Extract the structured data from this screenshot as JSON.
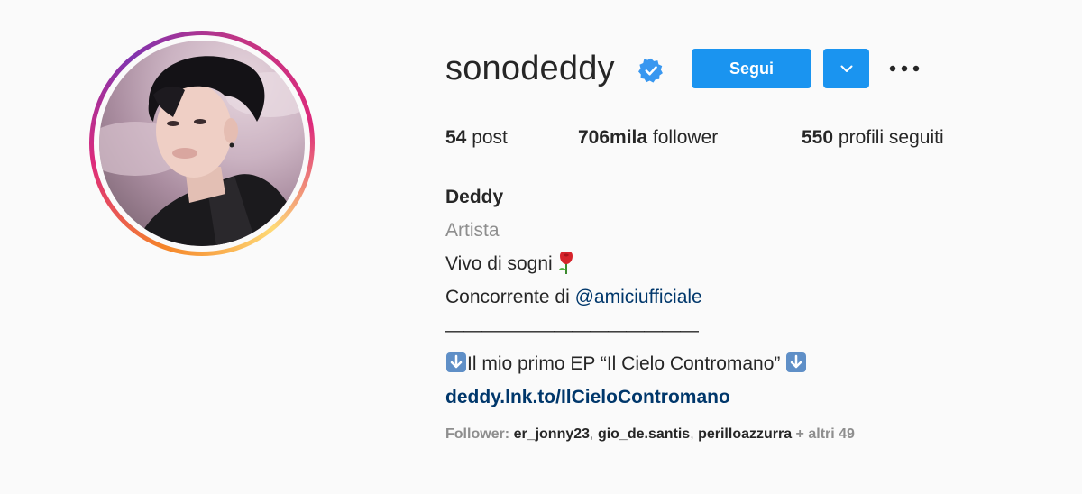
{
  "profile": {
    "username": "sonodeddy",
    "verified": true,
    "follow_label": "Segui",
    "stats": {
      "posts_count": "54",
      "posts_label": "post",
      "followers_count": "706mila",
      "followers_label": "follower",
      "following_count": "550",
      "following_label": "profili seguiti"
    },
    "bio": {
      "name": "Deddy",
      "category": "Artista",
      "line1": "Vivo di sogni",
      "line2_prefix": "Concorrente di ",
      "line2_mention": "@amiciufficiale",
      "divider": "——————————————",
      "line3": "Il mio primo EP “Il Cielo Contromano” ",
      "link": "deddy.lnk.to/IlCieloContromano"
    },
    "followed_by": {
      "label": "Follower: ",
      "names": [
        "er_jonny23",
        "gio_de.santis",
        "perilloazzurra"
      ],
      "separator": ", ",
      "more": " + altri 49"
    }
  },
  "icons": {
    "verified": "verified-badge-icon",
    "dropdown": "chevron-down-icon",
    "more": "more-options-icon",
    "rose": "rose-emoji-icon",
    "down_arrow": "down-arrow-emoji-icon"
  },
  "colors": {
    "primary_button": "#1a94f0",
    "link": "#00376b",
    "secondary_text": "#8e8e8e",
    "text": "#262626",
    "background": "#fafafa"
  }
}
